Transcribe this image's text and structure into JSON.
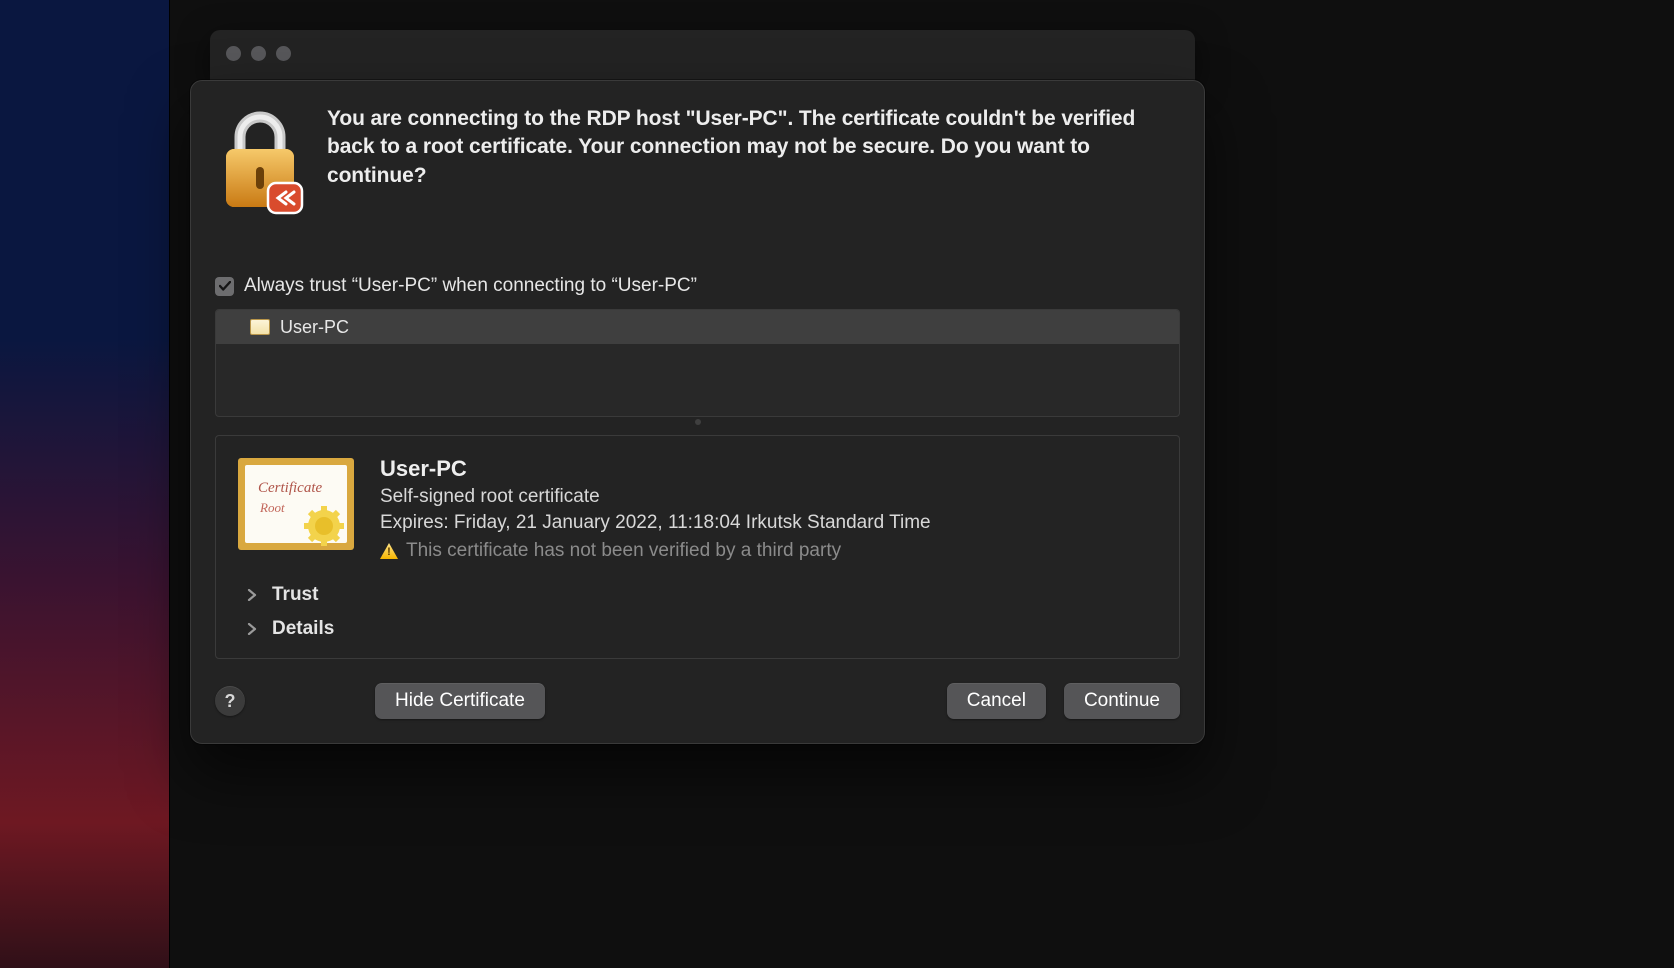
{
  "dialog": {
    "message": "You are connecting to the RDP host \"User-PC\". The certificate couldn't be verified back to a root certificate. Your connection may not be secure. Do you want to continue?",
    "always_trust_label": "Always trust “User-PC” when connecting to “User-PC”",
    "always_trust_checked": true
  },
  "certificate_list": {
    "items": [
      {
        "name": "User-PC"
      }
    ]
  },
  "certificate": {
    "name": "User-PC",
    "kind": "Self-signed root certificate",
    "expires": "Expires: Friday, 21 January 2022, 11:18:04 Irkutsk Standard Time",
    "warning": "This certificate has not been verified by a third party"
  },
  "disclosures": {
    "trust": "Trust",
    "details": "Details"
  },
  "buttons": {
    "hide_certificate": "Hide Certificate",
    "cancel": "Cancel",
    "continue": "Continue"
  }
}
